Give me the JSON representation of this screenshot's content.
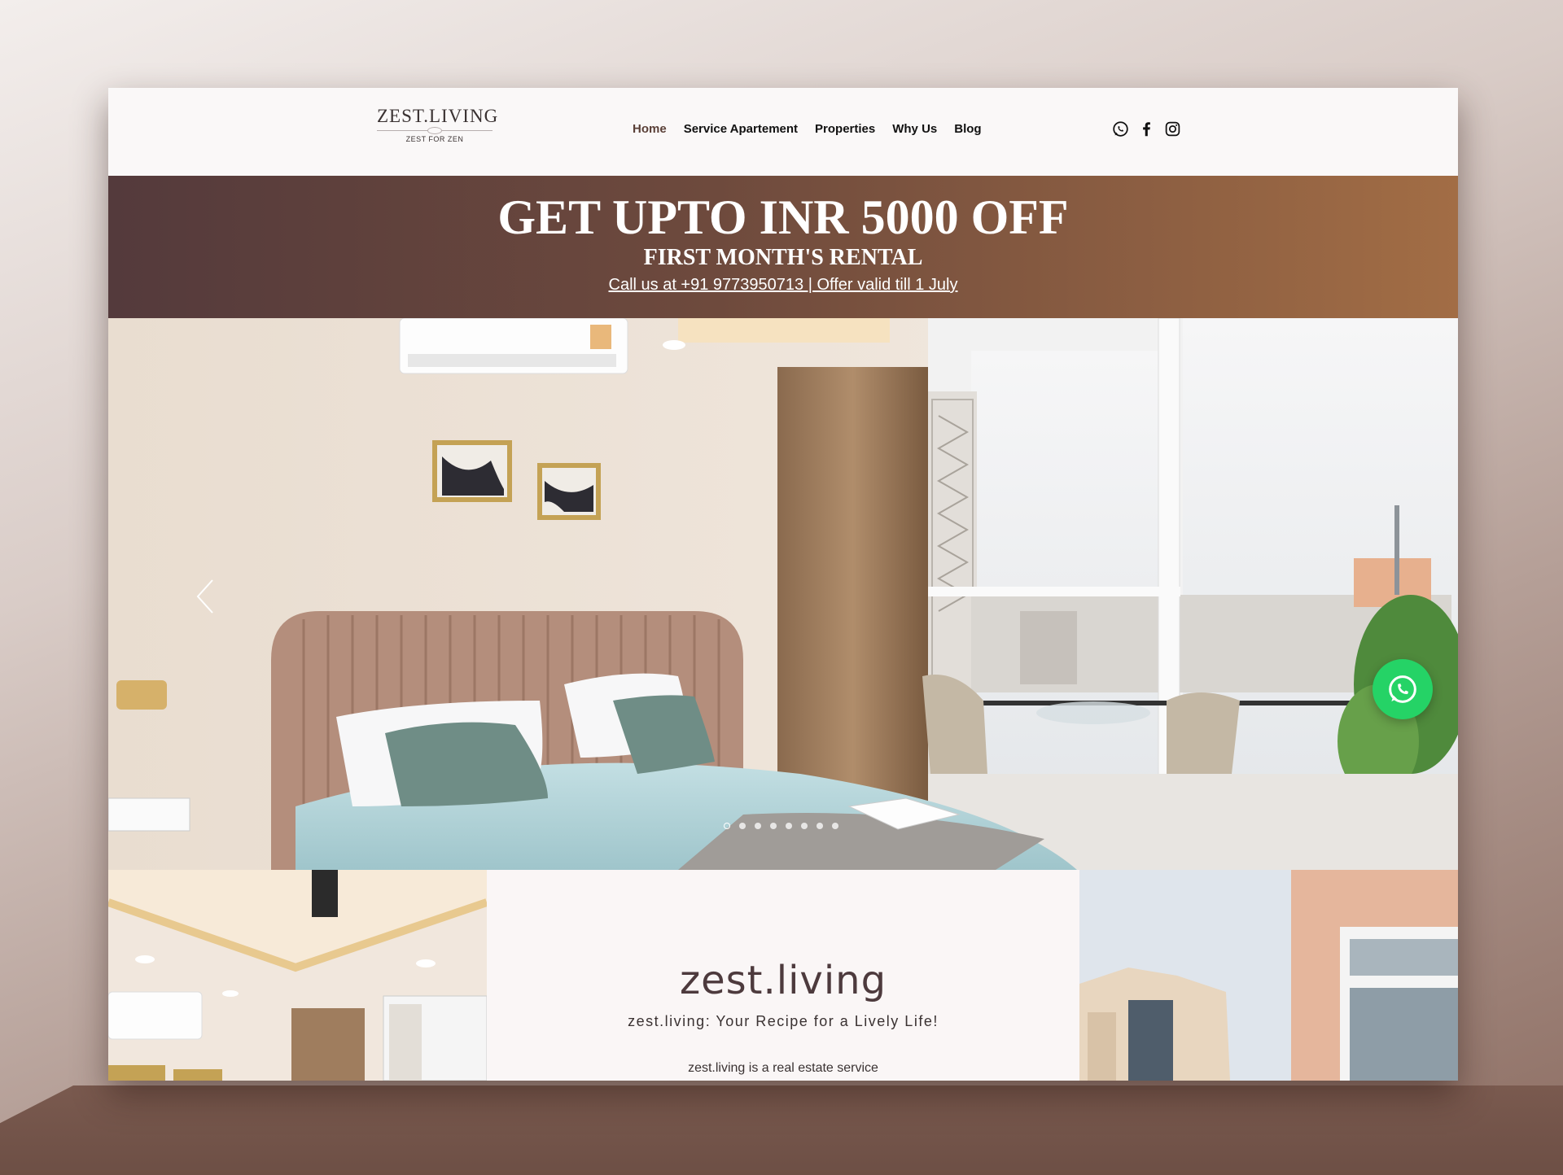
{
  "header": {
    "logo_main": "ZEST.LIVING",
    "logo_sub": "ZEST FOR ZEN",
    "nav": [
      "Home",
      "Service Apartement",
      "Properties",
      "Why Us",
      "Blog"
    ],
    "social": [
      "whatsapp-icon",
      "facebook-icon",
      "instagram-icon"
    ]
  },
  "promo": {
    "headline": "GET UPTO INR 5000 OFF",
    "subline": "FIRST MONTH'S RENTAL",
    "call": "Call us at +91 9773950713 | Offer valid till 1 July"
  },
  "slider": {
    "total_slides": 8,
    "active_slide": 1
  },
  "about": {
    "title": "zest.living",
    "tagline": "zest.living: Your Recipe for a Lively Life!",
    "description": "zest.living is a real estate service"
  },
  "colors": {
    "accent": "#6e4a3d",
    "whatsapp": "#25d366"
  }
}
